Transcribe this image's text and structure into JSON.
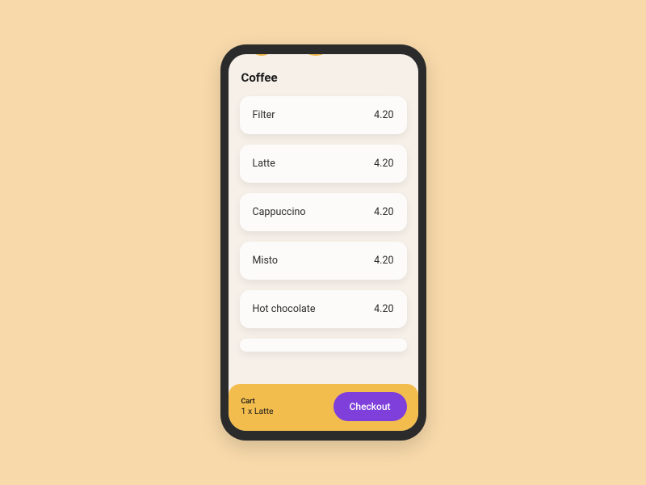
{
  "page_title": "Coffee",
  "menu": {
    "items": [
      {
        "name": "Filter",
        "price": "4.20"
      },
      {
        "name": "Latte",
        "price": "4.20"
      },
      {
        "name": "Cappuccino",
        "price": "4.20"
      },
      {
        "name": "Misto",
        "price": "4.20"
      },
      {
        "name": "Hot chocolate",
        "price": "4.20"
      }
    ]
  },
  "cart": {
    "label": "Cart",
    "summary": "1 x Latte",
    "checkout_label": "Checkout"
  },
  "colors": {
    "background": "#F7D9AA",
    "frame": "#2B2B2B",
    "screen": "#F6F0E9",
    "accent": "#F3BD4E",
    "primary": "#7E3FDB"
  }
}
